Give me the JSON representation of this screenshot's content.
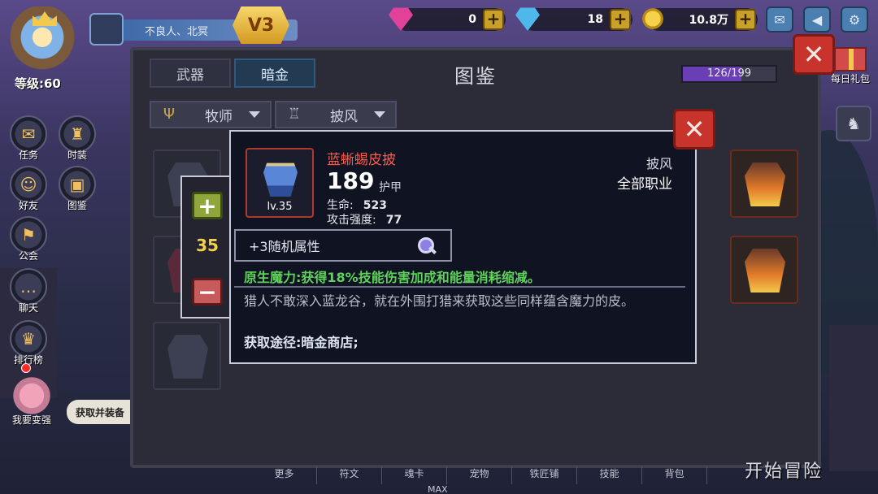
{
  "header": {
    "level_text": "等级:60",
    "player_name": "不良人、北冥",
    "vip": "V3"
  },
  "currencies": [
    {
      "icon": "ruby-gem-icon",
      "value": "0"
    },
    {
      "icon": "diamond-icon",
      "value": "18"
    },
    {
      "icon": "gold-coin-icon",
      "value": "10.8万"
    }
  ],
  "plus": "+",
  "side_menu": [
    {
      "key": "quest",
      "label": "任务",
      "glyph": "✉"
    },
    {
      "key": "costume",
      "label": "时装",
      "glyph": "♜"
    },
    {
      "key": "friends",
      "label": "好友",
      "glyph": "☺"
    },
    {
      "key": "collection",
      "label": "图鉴",
      "glyph": "▣"
    },
    {
      "key": "guild",
      "label": "公会",
      "glyph": "⚑"
    },
    {
      "key": "chat",
      "label": "聊天",
      "glyph": "…"
    },
    {
      "key": "ranking",
      "label": "排行榜",
      "glyph": "♛"
    }
  ],
  "collection_tab": {
    "label": "图鉴"
  },
  "stronger": {
    "label": "我要变强",
    "get_equip": "获取并装备"
  },
  "gift": {
    "label": "每日礼包"
  },
  "panel": {
    "title": "图鉴",
    "tabs": [
      {
        "label": "武器"
      },
      {
        "label": "暗金"
      }
    ],
    "active_tab": 1,
    "progress_text": "126/199",
    "progress_fraction": 0.633,
    "filters": [
      {
        "label": "牧师",
        "icon": "trident-icon"
      },
      {
        "label": "披风",
        "icon": "cloak-icon"
      }
    ]
  },
  "stepper": {
    "value": "35",
    "plus": "+",
    "minus": "−"
  },
  "item": {
    "name": "蓝蜥蜴皮披",
    "level": "lv.35",
    "power": "189",
    "power_label": "护甲",
    "stats": [
      {
        "label": "生命:",
        "value": "523"
      },
      {
        "label": "攻击强度:",
        "value": "77"
      }
    ],
    "slot_type": "披风",
    "class_req": "全部职业",
    "random_attr": "+3随机属性",
    "innate": "原生魔力:获得18%技能伤害加成和能量消耗缩减。",
    "description": "猎人不敢深入蓝龙谷，就在外围打猎来获取这些同样蕴含魔力的皮。",
    "source": "获取途径:暗金商店;"
  },
  "close_symbol": "✕",
  "bottom_nav": [
    "更多",
    "符文",
    "魂卡",
    "宠物",
    "铁匠铺",
    "技能",
    "背包"
  ],
  "bottom_max": "MAX",
  "adventure": "开始冒险",
  "colors": {
    "accent_red": "#c8332b",
    "item_name": "#ff5a4a",
    "innate_green": "#5fd25a",
    "progress_purple": "#6a3fb5"
  }
}
